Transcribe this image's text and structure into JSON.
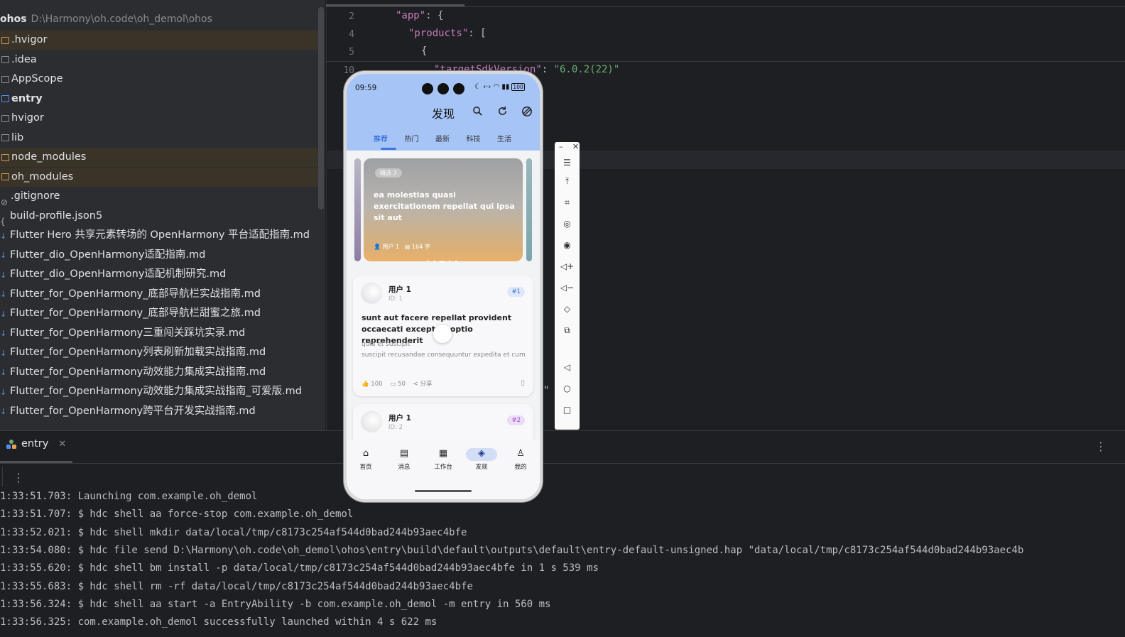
{
  "project": {
    "root_name": "ohos",
    "root_path": "D:\\Harmony\\oh.code\\oh_demol\\ohos",
    "items": [
      {
        "label": ".hvigor",
        "kind": "folder",
        "highlight": true
      },
      {
        "label": ".idea",
        "kind": "folder"
      },
      {
        "label": "AppScope",
        "kind": "folder"
      },
      {
        "label": "entry",
        "kind": "module",
        "bold": true
      },
      {
        "label": "hvigor",
        "kind": "folder"
      },
      {
        "label": "lib",
        "kind": "folder"
      },
      {
        "label": "node_modules",
        "kind": "folder",
        "highlight": true
      },
      {
        "label": "oh_modules",
        "kind": "folder",
        "highlight": true
      },
      {
        "label": ".gitignore",
        "kind": "ignore"
      },
      {
        "label": "build-profile.json5",
        "kind": "json"
      },
      {
        "label": "Flutter Hero 共享元素转场的 OpenHarmony 平台适配指南.md",
        "kind": "md"
      },
      {
        "label": "Flutter_dio_OpenHarmony适配指南.md",
        "kind": "md"
      },
      {
        "label": "Flutter_dio_OpenHarmony适配机制研究.md",
        "kind": "md"
      },
      {
        "label": "Flutter_for_OpenHarmony_底部导航栏实战指南.md",
        "kind": "md"
      },
      {
        "label": "Flutter_for_OpenHarmony_底部导航栏甜蜜之旅.md",
        "kind": "md"
      },
      {
        "label": "Flutter_for_OpenHarmony三重闯关踩坑实录.md",
        "kind": "md"
      },
      {
        "label": "Flutter_for_OpenHarmony列表刷新加载实战指南.md",
        "kind": "md"
      },
      {
        "label": "Flutter_for_OpenHarmony动效能力集成实战指南.md",
        "kind": "md"
      },
      {
        "label": "Flutter_for_OpenHarmony动效能力集成实战指南_可爱版.md",
        "kind": "md"
      },
      {
        "label": "Flutter_for_OpenHarmony跨平台开发实战指南.md",
        "kind": "md"
      }
    ]
  },
  "editor": {
    "gutter": [
      "2",
      "4",
      "5",
      "10"
    ],
    "lines": {
      "l2_key": "\"app\"",
      "l2_rest": ": {",
      "l4_key": "\"products\"",
      "l4_rest": ": [",
      "l5": "{",
      "l10_key": "\"targetSdkVersion\"",
      "l10_sep": ": ",
      "l10_val": "\"6.0.2(22)\""
    },
    "stray_quote": "\""
  },
  "run_panel": {
    "tab_label": "entry",
    "logs": [
      "1:33:51.703: Launching com.example.oh_demol",
      "1:33:51.707: $ hdc shell aa force-stop com.example.oh_demol",
      "1:33:52.021: $ hdc shell mkdir data/local/tmp/c8173c254af544d0bad244b93aec4bfe",
      "1:33:54.080: $ hdc file send D:\\Harmony\\oh.code\\oh_demol\\ohos\\entry\\build\\default\\outputs\\default\\entry-default-unsigned.hap \"data/local/tmp/c8173c254af544d0bad244b93aec4b",
      "1:33:55.620: $ hdc shell bm install -p data/local/tmp/c8173c254af544d0bad244b93aec4bfe in 1 s 539 ms",
      "1:33:55.683: $ hdc shell rm -rf data/local/tmp/c8173c254af544d0bad244b93aec4bfe",
      "1:33:56.324: $ hdc shell aa start -a EntryAbility -b com.example.oh_demol -m entry in 560 ms",
      "1:33:56.325: com.example.oh_demol successfully launched within 4 s 622 ms"
    ]
  },
  "phone": {
    "status_time": "09:59",
    "battery": "100",
    "title": "发现",
    "tabs": [
      "推荐",
      "热门",
      "最新",
      "科技",
      "生活"
    ],
    "active_tab": 0,
    "banner": {
      "tag": "精选 3",
      "title": "ea molestias quasi exercitationem repellat qui ipsa sit aut",
      "user": "用户 1",
      "words": "164 字"
    },
    "posts": [
      {
        "user": "用户 1",
        "id": "ID: 1",
        "badge": "#1",
        "title": "sunt aut facere repellat provident occaecati excepturi optio reprehenderit",
        "body": "quia et suscipit\nsuscipit recusandae consequuntur expedita et cum",
        "likes": "100",
        "comments": "50",
        "share": "分享"
      },
      {
        "user": "用户 1",
        "id": "ID: 2",
        "badge": "#2"
      }
    ],
    "nav": [
      {
        "label": "首页",
        "icon": "home-icon"
      },
      {
        "label": "消息",
        "icon": "message-icon"
      },
      {
        "label": "工作台",
        "icon": "grid-icon"
      },
      {
        "label": "发现",
        "icon": "compass-icon"
      },
      {
        "label": "我的",
        "icon": "user-icon"
      }
    ],
    "active_nav": 3
  },
  "colors": {
    "header_blue": "#a6c4f5",
    "accent": "#1558d6",
    "badge1_bg": "#dde8fb",
    "badge2_bg": "#ecdcf6"
  }
}
